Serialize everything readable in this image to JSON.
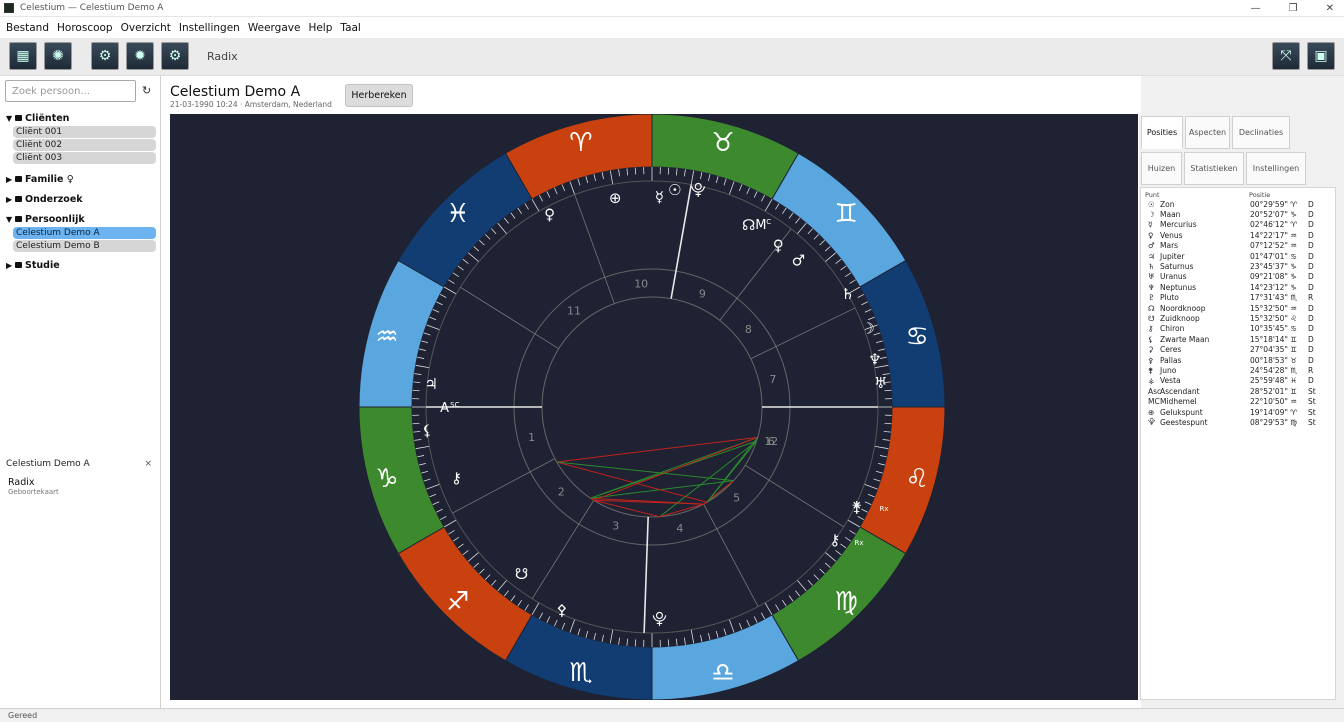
{
  "window": {
    "title": "Celestium — Celestium Demo A",
    "controls": [
      "—",
      "❐",
      "✕"
    ]
  },
  "menu": [
    "Bestand",
    "Horoscoop",
    "Overzicht",
    "Instellingen",
    "Weergave",
    "Help",
    "Taal"
  ],
  "toolbar": {
    "label": "Radix",
    "left_icons": [
      "layout-icon",
      "wheel-icon",
      "gear-chart-icon",
      "transit-icon",
      "progress-icon"
    ],
    "right_icons": [
      "compare-icon",
      "panel-icon"
    ]
  },
  "sidebar": {
    "search_placeholder": "Zoek persoon...",
    "refresh": "↻",
    "groups": [
      {
        "name": "Cliënten",
        "expanded": true,
        "items": [
          "Cliënt 001",
          "Cliënt 002",
          "Cliënt 003"
        ]
      },
      {
        "name": "Familie ♀",
        "expanded": false,
        "items": []
      },
      {
        "name": "Onderzoek",
        "expanded": false,
        "items": []
      },
      {
        "name": "Persoonlijk",
        "expanded": true,
        "items": [
          "Celestium Demo A",
          "Celestium Demo B"
        ],
        "selected": "Celestium Demo A"
      },
      {
        "name": "Studie",
        "expanded": false,
        "items": []
      }
    ],
    "open_chart": {
      "name": "Celestium Demo A",
      "close": "×",
      "type": "Radix",
      "subtype": "Geboortekaart"
    }
  },
  "header": {
    "name": "Celestium Demo A",
    "meta": "21-03-1990 10:24 · Amsterdam, Nederland",
    "recalc": "Herbereken"
  },
  "tabs": {
    "row1": [
      {
        "label": "Posities",
        "active": true
      },
      {
        "label": "Aspecten",
        "active": false
      },
      {
        "label": "Declinaties",
        "active": false
      }
    ],
    "row2": [
      {
        "label": "Huizen",
        "active": false
      },
      {
        "label": "Statistieken",
        "active": false
      },
      {
        "label": "Instellingen",
        "active": false
      }
    ]
  },
  "positions": {
    "col_point": "Punt",
    "col_pos": "Positie",
    "rows": [
      {
        "g": "☉",
        "n": "Zon",
        "p": "00°29'59\" ♈",
        "f": "D"
      },
      {
        "g": "☽",
        "n": "Maan",
        "p": "20°52'07\" ♑",
        "f": "D"
      },
      {
        "g": "☿",
        "n": "Mercurius",
        "p": "02°46'12\" ♈",
        "f": "D"
      },
      {
        "g": "♀",
        "n": "Venus",
        "p": "14°22'17\" ♒",
        "f": "D"
      },
      {
        "g": "♂",
        "n": "Mars",
        "p": "07°12'52\" ♒",
        "f": "D"
      },
      {
        "g": "♃",
        "n": "Jupiter",
        "p": "01°47'01\" ♋",
        "f": "D"
      },
      {
        "g": "♄",
        "n": "Saturnus",
        "p": "23°45'37\" ♑",
        "f": "D"
      },
      {
        "g": "♅",
        "n": "Uranus",
        "p": "09°21'08\" ♑",
        "f": "D"
      },
      {
        "g": "♆",
        "n": "Neptunus",
        "p": "14°23'12\" ♑",
        "f": "D"
      },
      {
        "g": "♇",
        "n": "Pluto",
        "p": "17°31'43\" ♏",
        "f": "R"
      },
      {
        "g": "☊",
        "n": "Noordknoop",
        "p": "15°32'50\" ♒",
        "f": "D"
      },
      {
        "g": "☋",
        "n": "Zuidknoop",
        "p": "15°32'50\" ♌",
        "f": "D"
      },
      {
        "g": "⚷",
        "n": "Chiron",
        "p": "10°35'45\" ♋",
        "f": "D"
      },
      {
        "g": "⚸",
        "n": "Zwarte Maan",
        "p": "15°18'14\" ♊",
        "f": "D"
      },
      {
        "g": "⚳",
        "n": "Ceres",
        "p": "27°04'35\" ♊",
        "f": "D"
      },
      {
        "g": "⚴",
        "n": "Pallas",
        "p": "00°18'53\" ♉",
        "f": "D"
      },
      {
        "g": "⚵",
        "n": "Juno",
        "p": "24°54'28\" ♏",
        "f": "R"
      },
      {
        "g": "⚶",
        "n": "Vesta",
        "p": "25°59'48\" ♓",
        "f": "D"
      },
      {
        "g": "Asc",
        "n": "Ascendant",
        "p": "28°52'01\" ♊",
        "f": "St"
      },
      {
        "g": "MC",
        "n": "Midhemel",
        "p": "22°10'50\" ♒",
        "f": "St"
      },
      {
        "g": "⊕",
        "n": "Gelukspunt",
        "p": "19°14'09\" ♈",
        "f": "St"
      },
      {
        "g": "⯓",
        "n": "Geestespunt",
        "p": "08°29'53\" ♍",
        "f": "St"
      }
    ]
  },
  "wheel": {
    "signs": [
      "♈",
      "♉",
      "♊",
      "♋",
      "♌",
      "♍",
      "♎",
      "♏",
      "♐",
      "♑",
      "♒",
      "♓"
    ],
    "colors": {
      "fire": "#c9410e",
      "earth": "#3d8a2e",
      "air": "#5aa6de",
      "water": "#113d72",
      "bg": "#1e2233"
    },
    "asc_label": "A",
    "asc_sup": "SC",
    "mc_label": "M",
    "mc_sup": "C",
    "house_numbers": [
      "1",
      "2",
      "3",
      "4",
      "5",
      "6",
      "7",
      "8",
      "9",
      "10",
      "11",
      "12"
    ],
    "planet_glyphs": [
      "☿",
      "☉",
      "⯓",
      "⊕",
      "♀",
      "☊",
      "♀",
      "♂",
      "♄",
      "☽",
      "♆",
      "♅",
      "⚵",
      "⚷",
      "⯓",
      "⚷",
      "♃",
      "⚸",
      "☋",
      "⚴"
    ],
    "retro": "R",
    "retro_suffix": "x"
  },
  "status": "Gereed"
}
